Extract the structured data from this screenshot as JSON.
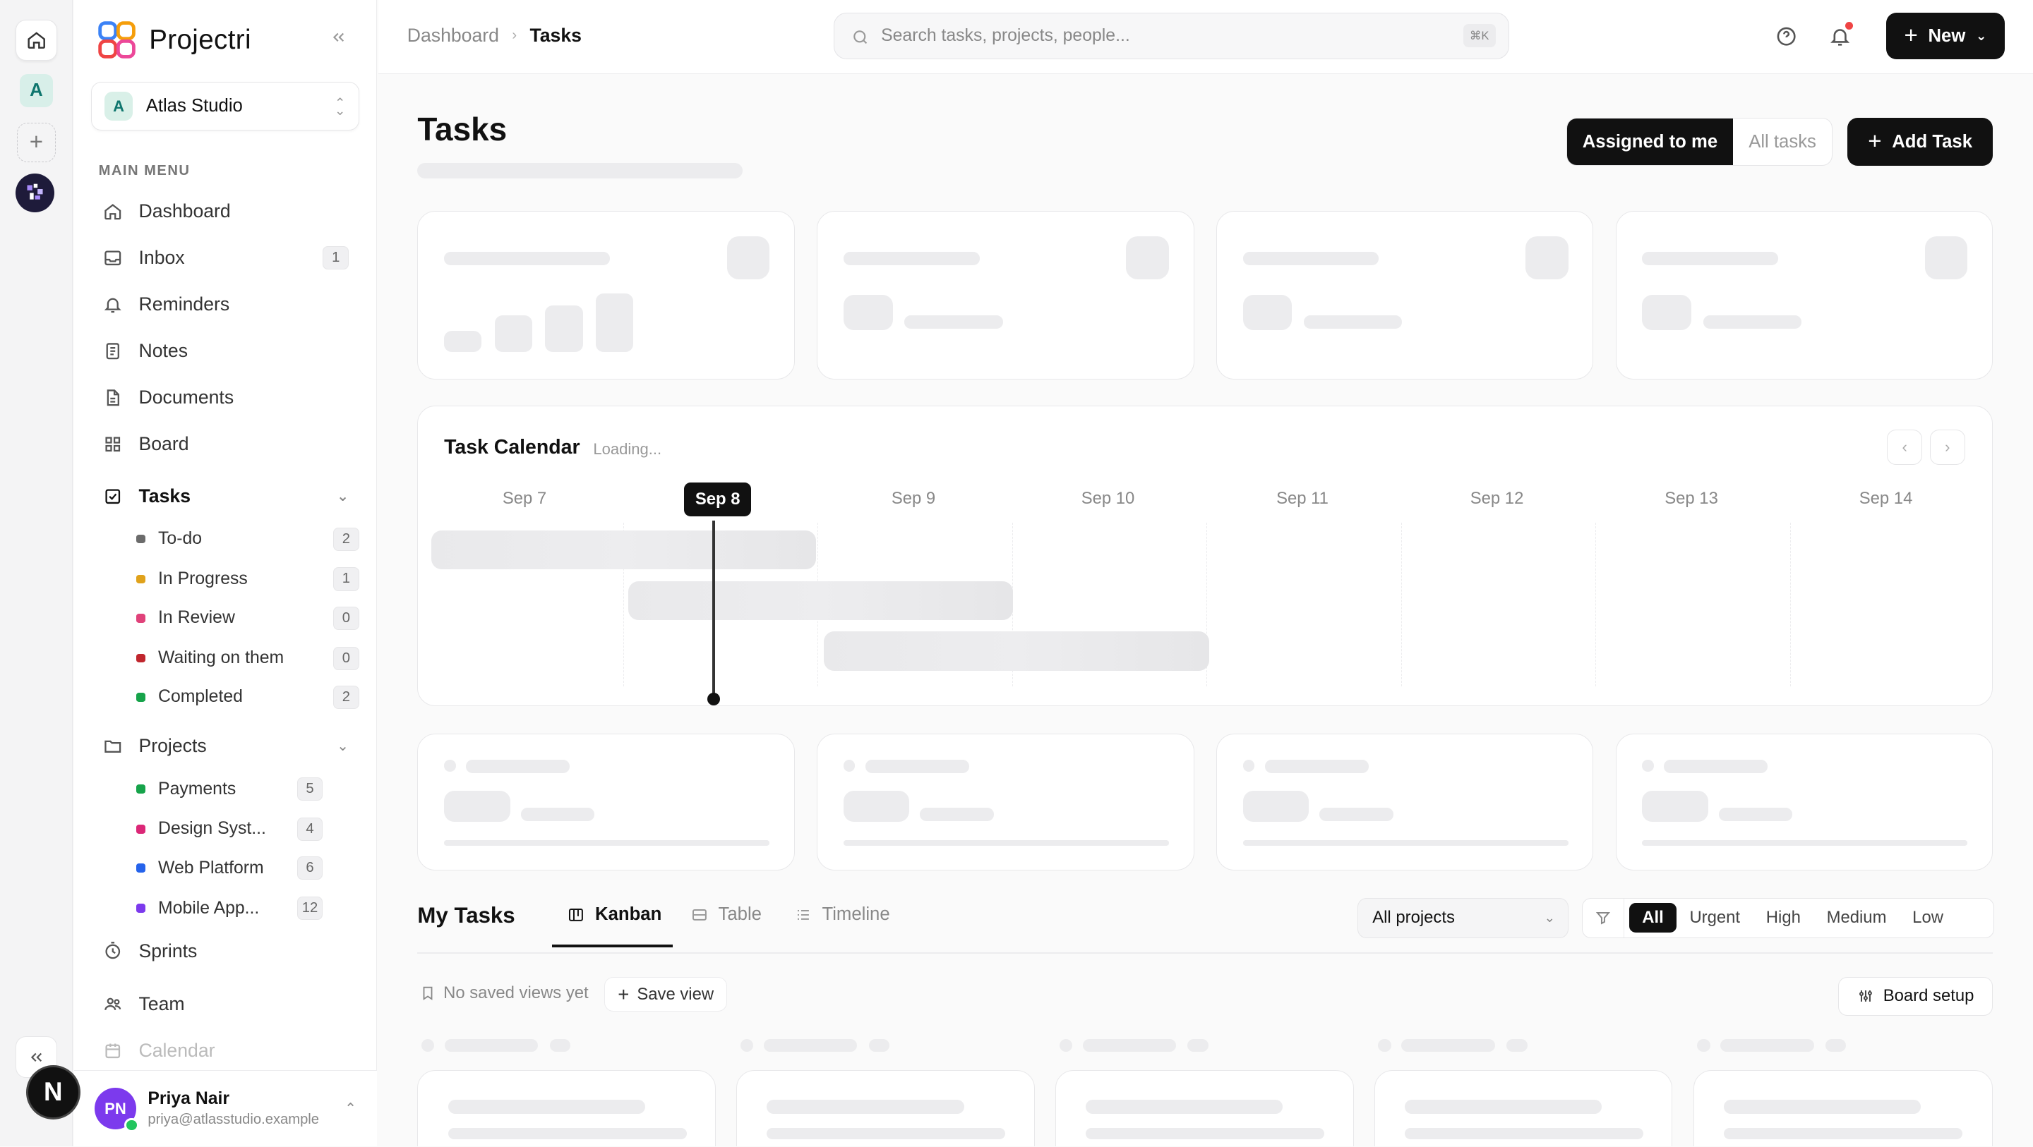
{
  "app": {
    "name": "Projectri"
  },
  "workspace": {
    "initial": "A",
    "name": "Atlas Studio"
  },
  "rail": {
    "workspace_initial": "A",
    "bottom_initial": "N"
  },
  "sidebar": {
    "section_label": "MAIN MENU",
    "items": [
      {
        "label": "Dashboard"
      },
      {
        "label": "Inbox",
        "badge": "1"
      },
      {
        "label": "Reminders"
      },
      {
        "label": "Notes"
      },
      {
        "label": "Documents"
      },
      {
        "label": "Board"
      },
      {
        "label": "Tasks"
      },
      {
        "label": "Projects"
      },
      {
        "label": "Sprints"
      },
      {
        "label": "Team"
      },
      {
        "label": "Calendar"
      }
    ],
    "task_statuses": [
      {
        "label": "To-do",
        "count": "2",
        "color": "#6b6b6b"
      },
      {
        "label": "In Progress",
        "count": "1",
        "color": "#e0a21b"
      },
      {
        "label": "In Review",
        "count": "0",
        "color": "#e0427a"
      },
      {
        "label": "Waiting on them",
        "count": "0",
        "color": "#c0262d"
      },
      {
        "label": "Completed",
        "count": "2",
        "color": "#16a34a"
      }
    ],
    "projects": [
      {
        "label": "Payments",
        "count": "5",
        "color": "#16a34a"
      },
      {
        "label": "Design Syst...",
        "count": "4",
        "color": "#db2777"
      },
      {
        "label": "Web Platform",
        "count": "6",
        "color": "#2563eb"
      },
      {
        "label": "Mobile App...",
        "count": "12",
        "color": "#7c3aed"
      }
    ]
  },
  "user": {
    "initials": "PN",
    "name": "Priya Nair",
    "email": "priya@atlasstudio.example"
  },
  "header": {
    "breadcrumb": [
      "Dashboard",
      "Tasks"
    ],
    "search_placeholder": "Search tasks, projects, people...",
    "search_shortcut": "⌘K",
    "new_label": "New"
  },
  "page": {
    "title": "Tasks",
    "scope_toggle": [
      "Assigned to me",
      "All tasks"
    ],
    "add_task_label": "Add Task"
  },
  "calendar": {
    "title": "Task Calendar",
    "status": "Loading...",
    "days": [
      "Sep 7",
      "Sep 8",
      "Sep 9",
      "Sep 10",
      "Sep 11",
      "Sep 12",
      "Sep 13",
      "Sep 14"
    ],
    "today": "Sep 8"
  },
  "my_tasks": {
    "title": "My Tasks",
    "tabs": [
      "Kanban",
      "Table",
      "Timeline"
    ],
    "active_tab": "Kanban",
    "project_filter": "All projects",
    "priorities": [
      "All",
      "Urgent",
      "High",
      "Medium",
      "Low"
    ],
    "active_priority": "All",
    "saved_views_empty": "No saved views yet",
    "save_view_label": "Save view",
    "board_setup_label": "Board setup"
  },
  "colors": {
    "accent": "#111111",
    "brand_red": "#e24c4c",
    "brand_blue": "#3b82f6"
  }
}
